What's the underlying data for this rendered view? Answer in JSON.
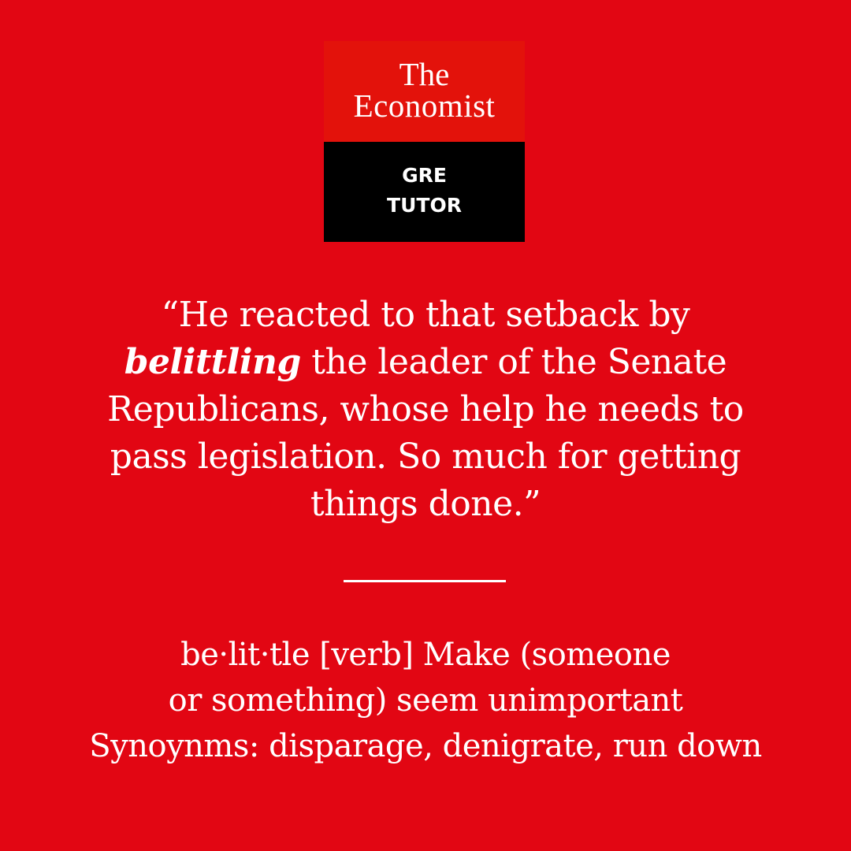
{
  "colors": {
    "background": "#e20613",
    "logo_top": "#e3120b",
    "logo_bottom": "#000000",
    "text": "#ffffff"
  },
  "logo": {
    "line1": "The",
    "line2": "Economist",
    "sub1": "GRE",
    "sub2": "TUTOR"
  },
  "quote": {
    "line1": "“He reacted to that setback by",
    "keyword": "belittling",
    "line2_rest": " the leader of the Senate",
    "line3": "Republicans, whose help he needs to",
    "line4": "pass legislation. So much for getting",
    "line5": "things done.”"
  },
  "definition": {
    "line1": "be·lit·tle [verb] Make (someone",
    "line2": "or something) seem unimportant",
    "line3": "Synoynms: disparage, denigrate, run down"
  }
}
